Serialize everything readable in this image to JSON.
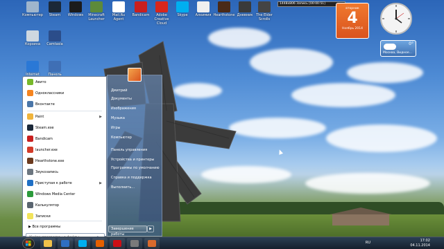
{
  "desktop": {
    "icons": [
      {
        "label": "Компьютер",
        "color": "#9fb5cc"
      },
      {
        "label": "Steam",
        "color": "#1b2838"
      },
      {
        "label": "Windows",
        "color": "#1b1b1b"
      },
      {
        "label": "Minecraft Launcher",
        "color": "#5d8a3a"
      },
      {
        "label": "Mail.Ru Agent",
        "color": "#ffffff"
      },
      {
        "label": "Bandicam",
        "color": "#c81f1f"
      },
      {
        "label": "Adobe Creative Cloud",
        "color": "#d8261c"
      },
      {
        "label": "Skype",
        "color": "#00aff0"
      },
      {
        "label": "Алхимия",
        "color": "#efefef"
      },
      {
        "label": "Hearthstone",
        "color": "#4a2a18"
      },
      {
        "label": "Дневник",
        "color": "#3a3a3a"
      },
      {
        "label": "The Elder Scrolls",
        "color": "#444444"
      },
      {
        "label": "Корзина",
        "color": "#cfd8e0"
      },
      {
        "label": "Camtasia",
        "color": "#2b4d8a"
      },
      {
        "label": "Internet Explorer",
        "color": "#2a78d6"
      },
      {
        "label": "Панель",
        "color": "#3f6fb5"
      }
    ]
  },
  "recorder": {
    "text": "1448х806      Запись [00:00:51]"
  },
  "calendar": {
    "weekday": "вторник",
    "day": "4",
    "month_year": "Ноябрь 2014"
  },
  "weather": {
    "temp": "0°",
    "city": "Москва, Видное..."
  },
  "start_menu": {
    "pinned": [
      {
        "label": "Авито",
        "color": "#77b82a"
      },
      {
        "label": "Одноклассники",
        "color": "#f5841f"
      },
      {
        "label": "Вконтакте",
        "color": "#4a76a8"
      }
    ],
    "recent": [
      {
        "label": "Paint",
        "color": "#f0b43c",
        "arrow": true
      },
      {
        "label": "Steam.exe",
        "color": "#1b2838",
        "arrow": false
      },
      {
        "label": "Bandicam",
        "color": "#c81f1f",
        "arrow": false
      },
      {
        "label": "launcher.exe",
        "color": "#d23a28",
        "arrow": false
      },
      {
        "label": "Hearthstone.exe",
        "color": "#6b3a1e",
        "arrow": false
      },
      {
        "label": "Звукозапись",
        "color": "#6c7680",
        "arrow": false
      },
      {
        "label": "Приступая к работе",
        "color": "#1f6fc5",
        "arrow": true
      },
      {
        "label": "Windows Media Center",
        "color": "#2b9a3b",
        "arrow": false
      },
      {
        "label": "Калькулятор",
        "color": "#5a6570",
        "arrow": false
      },
      {
        "label": "Записки",
        "color": "#f2e35b",
        "arrow": false
      }
    ],
    "all_programs": "Все программы",
    "search_placeholder": "Найти программы и файлы",
    "right_items": [
      "Дмитрий",
      "Документы",
      "Изображения",
      "Музыка",
      "Игры",
      "Компьютер",
      "Панель управления",
      "Устройства и принтеры",
      "Программы по умолчанию",
      "Справка и поддержка",
      "Выполнить..."
    ],
    "shutdown": "Завершение работы"
  },
  "taskbar": {
    "apps": [
      {
        "name": "explorer",
        "color": "#f2c24a"
      },
      {
        "name": "media-player",
        "color": "#2f6fc2"
      },
      {
        "name": "skype",
        "color": "#00aff0"
      },
      {
        "name": "firefox",
        "color": "#e66000"
      },
      {
        "name": "opera",
        "color": "#cc0f16"
      },
      {
        "name": "gadget",
        "color": "#7a7a7a"
      },
      {
        "name": "audio",
        "color": "#d96a2c"
      }
    ],
    "lang": "RU",
    "time": "17:02",
    "date": "04.11.2014"
  }
}
